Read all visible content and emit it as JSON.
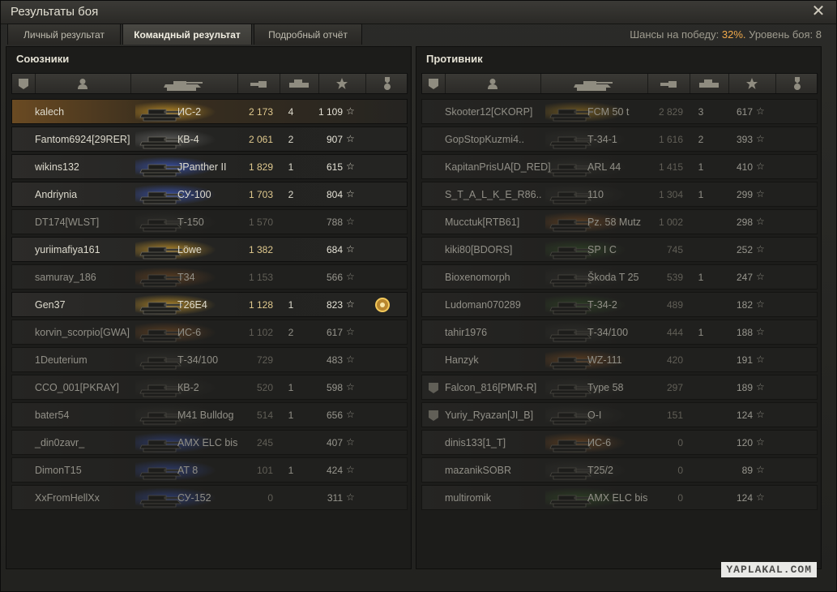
{
  "window": {
    "title": "Результаты боя"
  },
  "tabs": [
    "Личный результат",
    "Командный результат",
    "Подробный отчёт"
  ],
  "active_tab": 1,
  "header": {
    "chance_label": "Шансы на победу:",
    "chance_value": "32%.",
    "level_label": "Уровень боя: 8"
  },
  "watermark": "YAPLAKAL.COM",
  "allies": {
    "title": "Союзники",
    "rows": [
      {
        "name": "kalech",
        "tank": "ИС-2",
        "damage": "2 173",
        "kills": "4",
        "xp": "1 109",
        "color": "yellow",
        "state": "mine"
      },
      {
        "name": "Fantom6924[29RER]",
        "tank": "КВ-4",
        "damage": "2 061",
        "kills": "2",
        "xp": "907",
        "color": "grey",
        "state": "alive"
      },
      {
        "name": "wikins132",
        "tank": "JPanther II",
        "damage": "1 829",
        "kills": "1",
        "xp": "615",
        "color": "blue",
        "state": "alive"
      },
      {
        "name": "Andriynia",
        "tank": "СУ-100",
        "damage": "1 703",
        "kills": "2",
        "xp": "804",
        "color": "blue",
        "state": "alive"
      },
      {
        "name": "DT174[WLST]",
        "tank": "Т-150",
        "damage": "1 570",
        "kills": "",
        "xp": "788",
        "color": "dark",
        "state": "dead"
      },
      {
        "name": "yuriimafiya161",
        "tank": "Löwe",
        "damage": "1 382",
        "kills": "",
        "xp": "684",
        "color": "yellow",
        "state": "alive"
      },
      {
        "name": "samuray_186",
        "tank": "T34",
        "damage": "1 153",
        "kills": "",
        "xp": "566",
        "color": "orange",
        "state": "dead"
      },
      {
        "name": "Gen37",
        "tank": "T26E4",
        "damage": "1 128",
        "kills": "1",
        "xp": "823",
        "color": "yellow",
        "state": "alive",
        "medal": true
      },
      {
        "name": "korvin_scorpio[GWA]",
        "tank": "ИС-6",
        "damage": "1 102",
        "kills": "2",
        "xp": "617",
        "color": "orange",
        "state": "dead"
      },
      {
        "name": "1Deuterium",
        "tank": "Т-34/100",
        "damage": "729",
        "kills": "",
        "xp": "483",
        "color": "dark",
        "state": "dead"
      },
      {
        "name": "CCO_001[PKRAY]",
        "tank": "КВ-2",
        "damage": "520",
        "kills": "1",
        "xp": "598",
        "color": "dark",
        "state": "dead"
      },
      {
        "name": "bater54",
        "tank": "M41 Bulldog",
        "damage": "514",
        "kills": "1",
        "xp": "656",
        "color": "dark",
        "state": "dead"
      },
      {
        "name": "_din0zavr_",
        "tank": "AMX ELC bis",
        "damage": "245",
        "kills": "",
        "xp": "407",
        "color": "blue",
        "state": "dead"
      },
      {
        "name": "DimonT15",
        "tank": "AT 8",
        "damage": "101",
        "kills": "1",
        "xp": "424",
        "color": "blue",
        "state": "dead"
      },
      {
        "name": "XxFromHellXx",
        "tank": "СУ-152",
        "damage": "0",
        "kills": "",
        "xp": "311",
        "color": "blue",
        "state": "dead"
      }
    ]
  },
  "enemies": {
    "title": "Противник",
    "rows": [
      {
        "name": "Skooter12[CKORP]",
        "tank": "FCM 50 t",
        "damage": "2 829",
        "kills": "3",
        "xp": "617",
        "color": "yellow",
        "state": "dead"
      },
      {
        "name": "GopStopKuzmi4..",
        "tank": "Т-34-1",
        "damage": "1 616",
        "kills": "2",
        "xp": "393",
        "color": "dark",
        "state": "dead"
      },
      {
        "name": "KapitanPrisUA[D_RED]",
        "tank": "ARL 44",
        "damage": "1 415",
        "kills": "1",
        "xp": "410",
        "color": "dark",
        "state": "dead"
      },
      {
        "name": "S_T_A_L_K_E_R86..",
        "tank": "110",
        "damage": "1 304",
        "kills": "1",
        "xp": "299",
        "color": "dark",
        "state": "dead"
      },
      {
        "name": "Mucctuk[RTB61]",
        "tank": "Pz. 58 Mutz",
        "damage": "1 002",
        "kills": "",
        "xp": "298",
        "color": "orange",
        "state": "dead"
      },
      {
        "name": "kiki80[BDORS]",
        "tank": "SP I C",
        "damage": "745",
        "kills": "",
        "xp": "252",
        "color": "green",
        "state": "dead"
      },
      {
        "name": "Bioxenomorph",
        "tank": "Škoda T 25",
        "damage": "539",
        "kills": "1",
        "xp": "247",
        "color": "dark",
        "state": "dead"
      },
      {
        "name": "Ludoman070289",
        "tank": "Т-34-2",
        "damage": "489",
        "kills": "",
        "xp": "182",
        "color": "green",
        "state": "dead"
      },
      {
        "name": "tahir1976",
        "tank": "Т-34/100",
        "damage": "444",
        "kills": "1",
        "xp": "188",
        "color": "dark",
        "state": "dead"
      },
      {
        "name": "Hanzyk",
        "tank": "WZ-111",
        "damage": "420",
        "kills": "",
        "xp": "191",
        "color": "orange",
        "state": "dead"
      },
      {
        "name": "Falcon_816[PMR-R]",
        "tank": "Type 58",
        "damage": "297",
        "kills": "",
        "xp": "189",
        "color": "dark",
        "state": "dead",
        "badge": true
      },
      {
        "name": "Yuriy_Ryazan[JI_B]",
        "tank": "O-I",
        "damage": "151",
        "kills": "",
        "xp": "124",
        "color": "dark",
        "state": "dead",
        "badge": true
      },
      {
        "name": "dinis133[1_T]",
        "tank": "ИС-6",
        "damage": "0",
        "kills": "",
        "xp": "120",
        "color": "orange",
        "state": "dead"
      },
      {
        "name": "mazanikSOBR",
        "tank": "T25/2",
        "damage": "0",
        "kills": "",
        "xp": "89",
        "color": "dark",
        "state": "dead"
      },
      {
        "name": "multiromik",
        "tank": "AMX ELC bis",
        "damage": "0",
        "kills": "",
        "xp": "124",
        "color": "green",
        "state": "dead"
      }
    ]
  },
  "star_glyph": "☆",
  "icons": [
    "shield-icon",
    "player-icon",
    "tank-icon",
    "damage-icon",
    "kills-icon",
    "star-icon",
    "medal-icon"
  ]
}
